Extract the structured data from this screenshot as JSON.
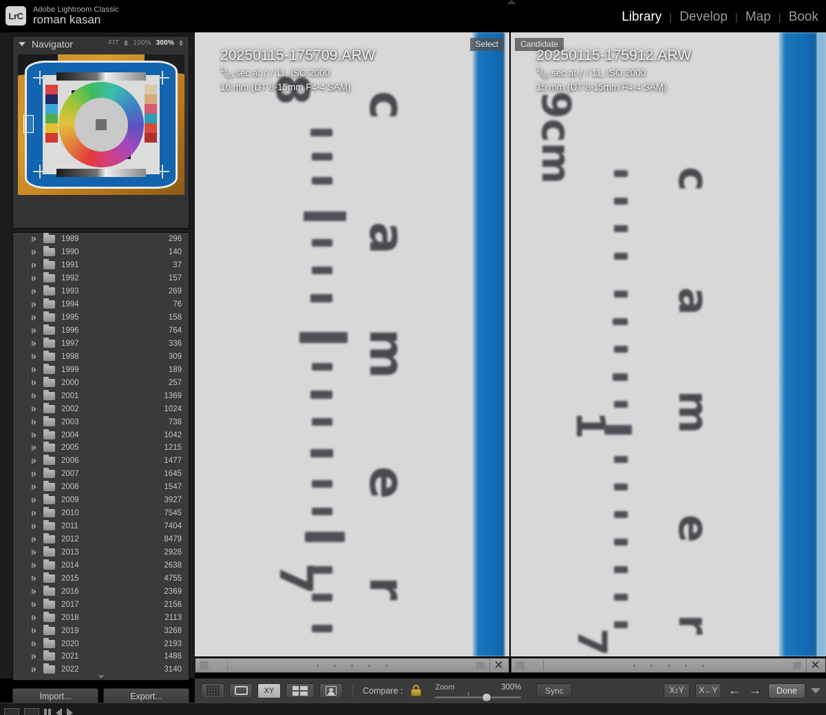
{
  "app": {
    "logo_text": "LrC",
    "product_name": "Adobe Lightroom Classic",
    "catalog_name": "roman kasan"
  },
  "modules": [
    {
      "label": "Library",
      "active": true
    },
    {
      "label": "Develop",
      "active": false
    },
    {
      "label": "Map",
      "active": false
    },
    {
      "label": "Book",
      "active": false
    }
  ],
  "navigator": {
    "title": "Navigator",
    "zoom_levels": [
      {
        "label": "FIT",
        "active": false,
        "has_stepper": true
      },
      {
        "label": "100%",
        "active": false,
        "has_stepper": false
      },
      {
        "label": "300%",
        "active": true,
        "has_stepper": true
      }
    ]
  },
  "folders": {
    "columns": [
      "name",
      "count"
    ],
    "rows": [
      {
        "name": "1989",
        "count": "296"
      },
      {
        "name": "1990",
        "count": "140"
      },
      {
        "name": "1991",
        "count": "37"
      },
      {
        "name": "1992",
        "count": "157"
      },
      {
        "name": "1993",
        "count": "269"
      },
      {
        "name": "1994",
        "count": "76"
      },
      {
        "name": "1995",
        "count": "158"
      },
      {
        "name": "1996",
        "count": "764"
      },
      {
        "name": "1997",
        "count": "336"
      },
      {
        "name": "1998",
        "count": "309"
      },
      {
        "name": "1999",
        "count": "189"
      },
      {
        "name": "2000",
        "count": "257"
      },
      {
        "name": "2001",
        "count": "1369"
      },
      {
        "name": "2002",
        "count": "1024"
      },
      {
        "name": "2003",
        "count": "738"
      },
      {
        "name": "2004",
        "count": "1042"
      },
      {
        "name": "2005",
        "count": "1215"
      },
      {
        "name": "2006",
        "count": "1477"
      },
      {
        "name": "2007",
        "count": "1645"
      },
      {
        "name": "2008",
        "count": "1547"
      },
      {
        "name": "2009",
        "count": "3927"
      },
      {
        "name": "2010",
        "count": "7545"
      },
      {
        "name": "2011",
        "count": "7404"
      },
      {
        "name": "2012",
        "count": "8479"
      },
      {
        "name": "2013",
        "count": "2926"
      },
      {
        "name": "2014",
        "count": "2638"
      },
      {
        "name": "2015",
        "count": "4755"
      },
      {
        "name": "2016",
        "count": "2369"
      },
      {
        "name": "2017",
        "count": "2156"
      },
      {
        "name": "2018",
        "count": "2113"
      },
      {
        "name": "2019",
        "count": "3268"
      },
      {
        "name": "2020",
        "count": "2193"
      },
      {
        "name": "2021",
        "count": "1486"
      },
      {
        "name": "2022",
        "count": "3140"
      }
    ]
  },
  "left_footer": {
    "import_label": "Import...",
    "export_label": "Export..."
  },
  "compare": {
    "select": {
      "badge": "Select",
      "filename": "20250115-175709.ARW",
      "shutter_numerator": "1",
      "shutter_denominator": "60",
      "exposure_rest": "sec at ƒ / 11, ISO 2000",
      "lens_line": "16 mm (DT 8-15mm F4-4 SAM)"
    },
    "candidate": {
      "badge": "Candidate",
      "filename": "20250115-175912.ARW",
      "shutter_numerator": "1",
      "shutter_denominator": "60",
      "exposure_rest": "sec at ƒ / 11, ISO 2000",
      "lens_line": "15 mm (DT 8-15mm F4-4 SAM)"
    }
  },
  "toolbar": {
    "view_modes": [
      {
        "name": "grid-view",
        "active": false
      },
      {
        "name": "loupe-view",
        "active": false
      },
      {
        "name": "compare-view",
        "label": "XY",
        "active": true
      },
      {
        "name": "survey-view",
        "active": false
      },
      {
        "name": "people-view",
        "active": false
      }
    ],
    "compare_label": "Compare :",
    "lock_state": "locked",
    "zoom_label": "Zoom",
    "zoom_value": "300%",
    "sync_label": "Sync",
    "swap_label": "X↕Y",
    "make_select_label": "X←Y",
    "prev_arrow": "←",
    "next_arrow": "→",
    "done_label": "Done"
  },
  "colors": {
    "panel_bg": "#3a3a3a",
    "app_bg": "#1c1c1c",
    "accent_blue": "#1b75bb",
    "text_primary": "#d8d8d8",
    "text_secondary": "#9a9a9a"
  }
}
